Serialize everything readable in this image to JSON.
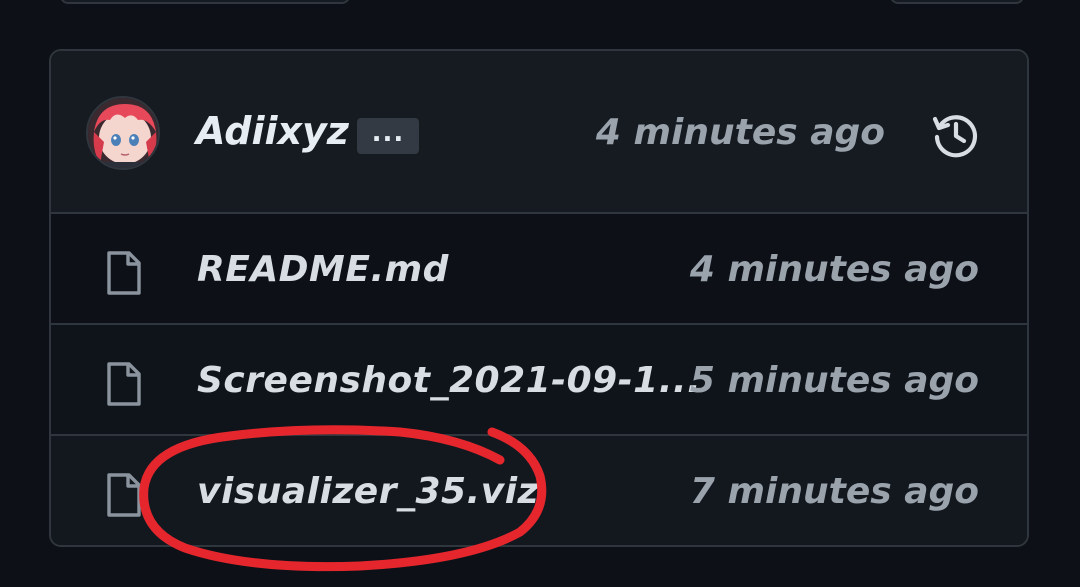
{
  "commit": {
    "author": "Adiixyz",
    "more_label": "...",
    "time": "4 minutes ago",
    "history_icon": "history-icon",
    "avatar_icon": "user-avatar"
  },
  "files": [
    {
      "name": "README.md",
      "time": "4 minutes ago",
      "icon": "file-icon"
    },
    {
      "name": "Screenshot_2021-09-1...",
      "time": "5 minutes ago",
      "icon": "file-icon"
    },
    {
      "name": "visualizer_35.viz",
      "time": "7 minutes ago",
      "icon": "file-icon"
    }
  ],
  "colors": {
    "background": "#0d1117",
    "header_bg": "#161b22",
    "border": "#30363d",
    "text_primary": "#e6edf3",
    "text_secondary": "#9aa2ac",
    "annotation_red": "#e5272d"
  }
}
